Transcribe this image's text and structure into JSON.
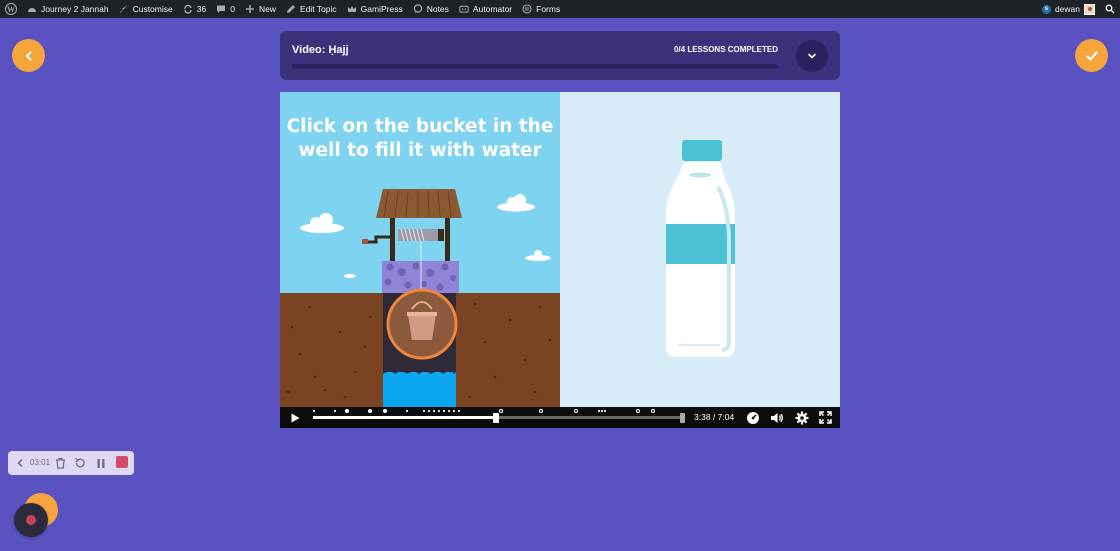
{
  "adminbar": {
    "site_name": "Journey 2 Jannah",
    "customise": "Customise",
    "updates_count": "36",
    "comments_count": "0",
    "new": "New",
    "edit_topic": "Edit Topic",
    "gamipress": "GamiPress",
    "notes": "Notes",
    "automator": "Automator",
    "forms": "Forms",
    "badge_letter": "s",
    "username": "dewan"
  },
  "lesson": {
    "title": "Video: Ḥajj",
    "lessons_completed": "0/4 LESSONS COMPLETED",
    "progress_fraction": 0
  },
  "video": {
    "instruction_line1": "Click on the bucket in the",
    "instruction_line2": "well to fill it with water",
    "time_display": "3:38 / 7:04",
    "played_fraction": 0.495
  },
  "recorder": {
    "elapsed": "03:01"
  },
  "colors": {
    "background": "#5b52c2",
    "accent": "#f6a43c",
    "header_card": "#3b327c",
    "sky": "#7dd3f0",
    "right_panel": "#d7ecf7"
  }
}
